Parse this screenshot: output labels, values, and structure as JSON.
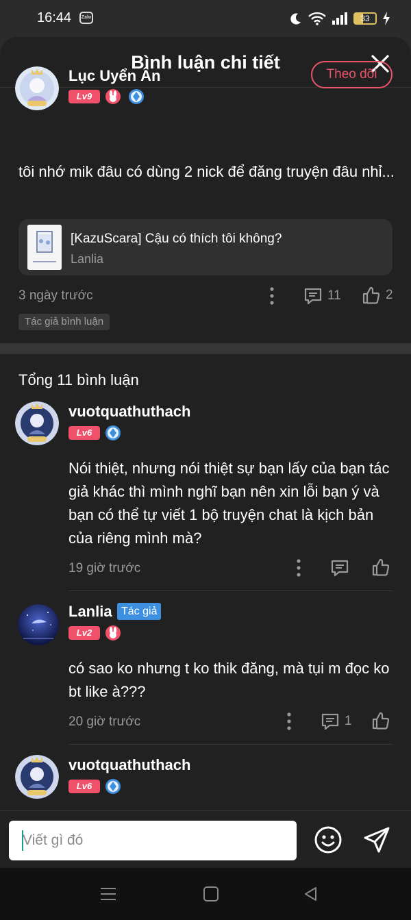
{
  "status_bar": {
    "time": "16:44",
    "notification_app": "Zalo",
    "battery_level": "33"
  },
  "header": {
    "title": "Bình luận chi tiết"
  },
  "main_comment": {
    "author": "Lục Uyển Ân",
    "level": "Lv9",
    "follow_label": "Theo dõi",
    "text": "tôi nhớ mik đâu có dùng 2 nick để đăng truyện đâu nhỉ...",
    "story": {
      "title": "[KazuScara] Cậu có thích tôi không?",
      "author": "Lanlia"
    },
    "time": "3 ngày trước",
    "reply_count": "11",
    "like_count": "2",
    "tag": "Tác giả bình luận"
  },
  "replies_header": {
    "total_label": "Tổng 11 bình luận"
  },
  "replies": [
    {
      "author": "vuotquathuthach",
      "level": "Lv6",
      "text": "Nói thiệt, nhưng nói thiệt sự bạn lấy của bạn tác giả khác thì mình nghĩ bạn nên xin lỗi bạn ý và bạn có thể tự viết 1 bộ truyện chat là kịch bản của riêng mình mà?",
      "time": "19 giờ trước"
    },
    {
      "author": "Lanlia",
      "author_label": "Tác giả",
      "level": "Lv2",
      "text": "có sao ko nhưng t ko thik đăng, mà tụi m đọc ko bt like à???",
      "time": "20 giờ trước",
      "reply_count": "1"
    },
    {
      "author": "vuotquathuthach",
      "level": "Lv6"
    }
  ],
  "composer": {
    "placeholder": "Viết gì đó"
  },
  "colors": {
    "accent": "#e8556a",
    "level_badge": "#f0506a",
    "author_label": "#3d8fe0",
    "sheet_bg": "#212121"
  }
}
